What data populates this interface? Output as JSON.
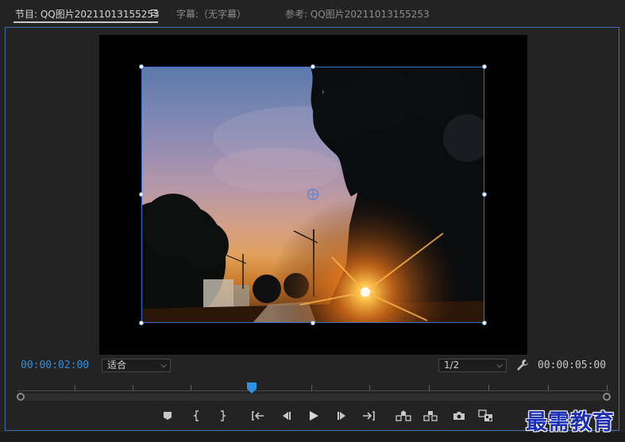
{
  "tabs": [
    {
      "label": "节目: QQ图片20211013155253",
      "active": true
    },
    {
      "label": "字幕:（无字幕）",
      "active": false
    },
    {
      "label": "参考: QQ图片20211013155253",
      "active": false
    }
  ],
  "tab_menu_icon": "hamburger-menu-icon",
  "timecode": {
    "current": "00:00:02:00",
    "duration": "00:00:05:00"
  },
  "zoom_select": {
    "value": "适合"
  },
  "resolution_select": {
    "value": "1/2"
  },
  "playhead_position": 0.39,
  "colors": {
    "accent": "#2e8fe3",
    "panel_border": "#3f6fb0",
    "watermark": "#1d2fb5"
  },
  "controls": [
    "add-marker-icon",
    "mark-in-icon",
    "mark-out-icon",
    "go-to-in-icon",
    "step-back-icon",
    "play-icon",
    "step-forward-icon",
    "go-to-out-icon",
    "lift-icon",
    "extract-icon",
    "export-frame-icon",
    "compare-view-icon"
  ],
  "watermark": {
    "text": "最需教育"
  }
}
